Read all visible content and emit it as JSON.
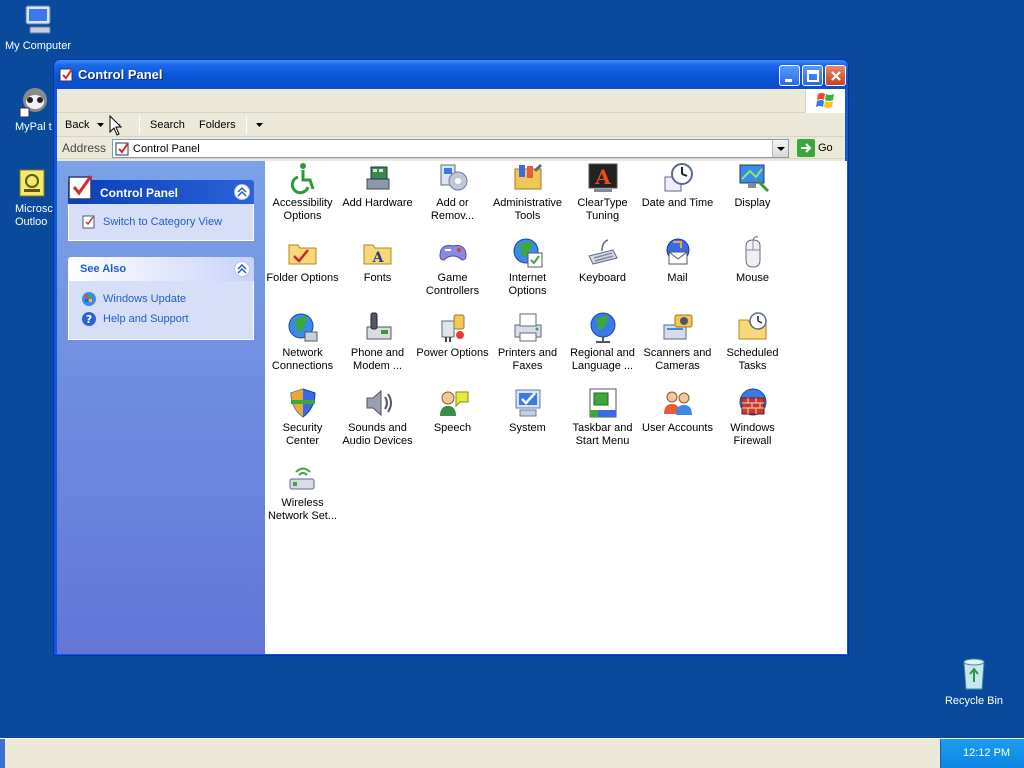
{
  "desktop": {
    "icons": [
      {
        "label": "My Computer"
      },
      {
        "label": "MyPal t"
      },
      {
        "label": "Microsc"
      },
      {
        "label": "Outloo"
      },
      {
        "label": "Recycle Bin"
      }
    ]
  },
  "window": {
    "title": "Control Panel",
    "toolbar": {
      "back": "Back",
      "search": "Search",
      "folders": "Folders"
    },
    "address": {
      "label": "Address",
      "value": "Control Panel",
      "go": "Go"
    }
  },
  "leftpane": {
    "control_panel_box": {
      "title": "Control Panel",
      "link": "Switch to Category View"
    },
    "see_also_box": {
      "title": "See Also",
      "links": [
        "Windows Update",
        "Help and Support"
      ]
    }
  },
  "items": [
    {
      "line1": "Accessibility",
      "line2": "Options",
      "icon": "accessibility-icon"
    },
    {
      "line1": "Add Hardware",
      "line2": "",
      "icon": "add-hardware-icon"
    },
    {
      "line1": "Add or",
      "line2": "Remov...",
      "icon": "add-remove-icon"
    },
    {
      "line1": "Administrative",
      "line2": "Tools",
      "icon": "admin-tools-icon"
    },
    {
      "line1": "ClearType",
      "line2": "Tuning",
      "icon": "cleartype-icon"
    },
    {
      "line1": "Date and Time",
      "line2": "",
      "icon": "clock-icon"
    },
    {
      "line1": "Display",
      "line2": "",
      "icon": "display-icon"
    },
    {
      "line1": "Folder Options",
      "line2": "",
      "icon": "folder-options-icon"
    },
    {
      "line1": "Fonts",
      "line2": "",
      "icon": "fonts-icon"
    },
    {
      "line1": "Game",
      "line2": "Controllers",
      "icon": "gamepad-icon"
    },
    {
      "line1": "Internet",
      "line2": "Options",
      "icon": "internet-icon"
    },
    {
      "line1": "Keyboard",
      "line2": "",
      "icon": "keyboard-icon"
    },
    {
      "line1": "Mail",
      "line2": "",
      "icon": "mail-icon"
    },
    {
      "line1": "Mouse",
      "line2": "",
      "icon": "mouse-icon"
    },
    {
      "line1": "Network",
      "line2": "Connections",
      "icon": "network-icon"
    },
    {
      "line1": "Phone and",
      "line2": "Modem ...",
      "icon": "phone-icon"
    },
    {
      "line1": "Power Options",
      "line2": "",
      "icon": "power-icon"
    },
    {
      "line1": "Printers and",
      "line2": "Faxes",
      "icon": "printer-icon"
    },
    {
      "line1": "Regional and",
      "line2": "Language ...",
      "icon": "globe-icon"
    },
    {
      "line1": "Scanners and",
      "line2": "Cameras",
      "icon": "scanner-icon"
    },
    {
      "line1": "Scheduled",
      "line2": "Tasks",
      "icon": "scheduled-tasks-icon"
    },
    {
      "line1": "Security",
      "line2": "Center",
      "icon": "shield-icon"
    },
    {
      "line1": "Sounds and",
      "line2": "Audio Devices",
      "icon": "speaker-icon"
    },
    {
      "line1": "Speech",
      "line2": "",
      "icon": "speech-icon"
    },
    {
      "line1": "System",
      "line2": "",
      "icon": "system-icon"
    },
    {
      "line1": "Taskbar and",
      "line2": "Start Menu",
      "icon": "taskbar-icon"
    },
    {
      "line1": "User Accounts",
      "line2": "",
      "icon": "users-icon"
    },
    {
      "line1": "Windows",
      "line2": "Firewall",
      "icon": "firewall-icon"
    },
    {
      "line1": "Wireless",
      "line2": "Network Set...",
      "icon": "wireless-icon"
    }
  ],
  "taskbar": {
    "clock": "12:12 PM"
  },
  "colors": {
    "desktop": "#0a4a9c",
    "titlebar": "#0a55d8",
    "link": "#215dc6",
    "tray": "#0c85e0"
  }
}
